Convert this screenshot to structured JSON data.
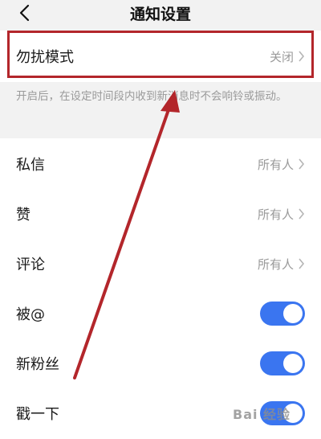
{
  "header": {
    "title": "通知设置"
  },
  "dnd": {
    "label": "勿扰模式",
    "value": "关闭"
  },
  "hint": {
    "text": "开启后，在设定时间段内收到新消息时不会响铃或振动。"
  },
  "settings": [
    {
      "label": "私信",
      "value": "所有人"
    },
    {
      "label": "赞",
      "value": "所有人"
    },
    {
      "label": "评论",
      "value": "所有人"
    }
  ],
  "toggles": [
    {
      "label": "被@",
      "on": true
    },
    {
      "label": "新粉丝",
      "on": true
    },
    {
      "label": "戳一下",
      "on": true
    }
  ],
  "watermark": {
    "text": "Bai 经验"
  },
  "colors": {
    "accent": "#3a75f0",
    "annotation": "#b3262b"
  }
}
